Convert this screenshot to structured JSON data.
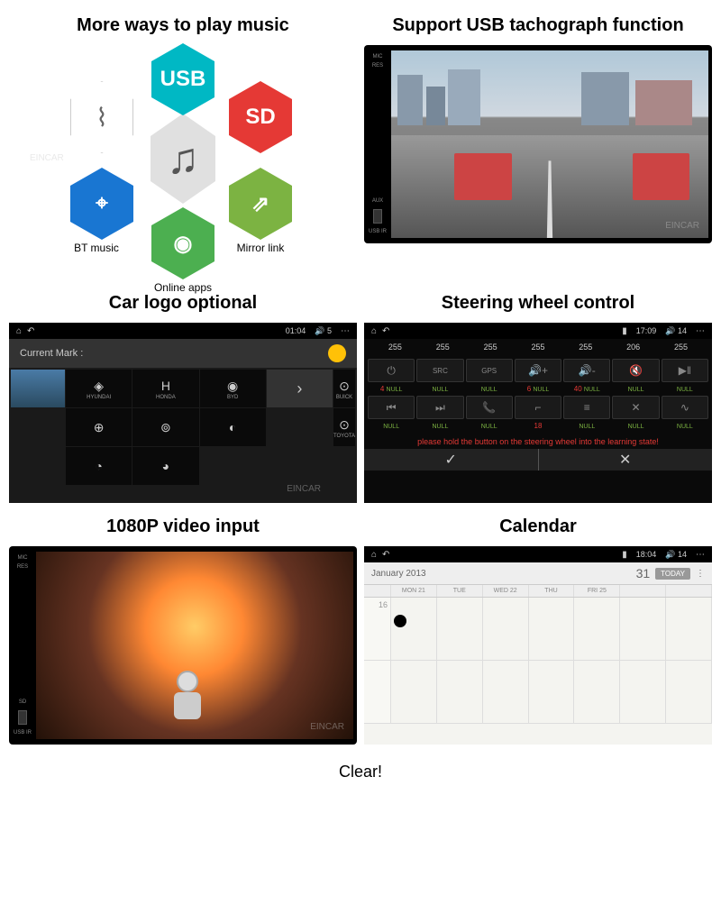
{
  "panels": {
    "music": {
      "title": "More ways to play music",
      "labels": {
        "bt": "BT music",
        "apps": "Online apps",
        "mirror": "Mirror link"
      },
      "icons": {
        "usb": "USB",
        "sd": "SD"
      }
    },
    "tachograph": {
      "title": "Support USB tachograph function",
      "bezel_labels": [
        "MIC",
        "RES",
        "",
        "AUX",
        "USB\nIR"
      ]
    },
    "carlogo": {
      "title": "Car logo optional",
      "status_time": "01:04",
      "status_vol": "5",
      "current_mark": "Current Mark :",
      "brands": [
        "HYUNDAI",
        "HONDA",
        "BYD",
        "BUICK",
        "",
        "",
        "",
        "",
        "TOYOTA",
        "",
        ""
      ]
    },
    "swc": {
      "title": "Steering wheel control",
      "status_time": "17:09",
      "status_vol": "14",
      "readouts": [
        "255",
        "255",
        "255",
        "255",
        "255",
        "206",
        "255"
      ],
      "row1_vals": [
        {
          "n": "4",
          "t": "NULL"
        },
        {
          "n": "",
          "t": "NULL"
        },
        {
          "n": "",
          "t": "NULL"
        },
        {
          "n": "6",
          "t": "NULL"
        },
        {
          "n": "40",
          "t": "NULL"
        },
        {
          "n": "",
          "t": "NULL"
        },
        {
          "n": "",
          "t": "NULL"
        }
      ],
      "row2_vals": [
        {
          "n": "",
          "t": "NULL"
        },
        {
          "n": "",
          "t": "NULL"
        },
        {
          "n": "",
          "t": "NULL"
        },
        {
          "n": "18",
          "t": ""
        },
        {
          "n": "",
          "t": "NULL"
        },
        {
          "n": "",
          "t": "NULL"
        },
        {
          "n": "",
          "t": "NULL"
        }
      ],
      "message": "please hold the button on the steering wheel into the learning state!"
    },
    "video": {
      "title": "1080P video input",
      "bezel_labels": [
        "MIC",
        "RES",
        "",
        "SD",
        "USB\nIR"
      ]
    },
    "calendar": {
      "title": "Calendar",
      "status_time": "18:04",
      "status_vol": "14",
      "month": "January 2013",
      "today_btn": "TODAY",
      "day_num": "31",
      "days": [
        "",
        "MON 21",
        "TUE",
        "WED 22",
        "THU",
        "FRI 25",
        "",
        ""
      ],
      "week_num": "16"
    }
  },
  "footer": "Clear!",
  "watermark": "EINCAR"
}
